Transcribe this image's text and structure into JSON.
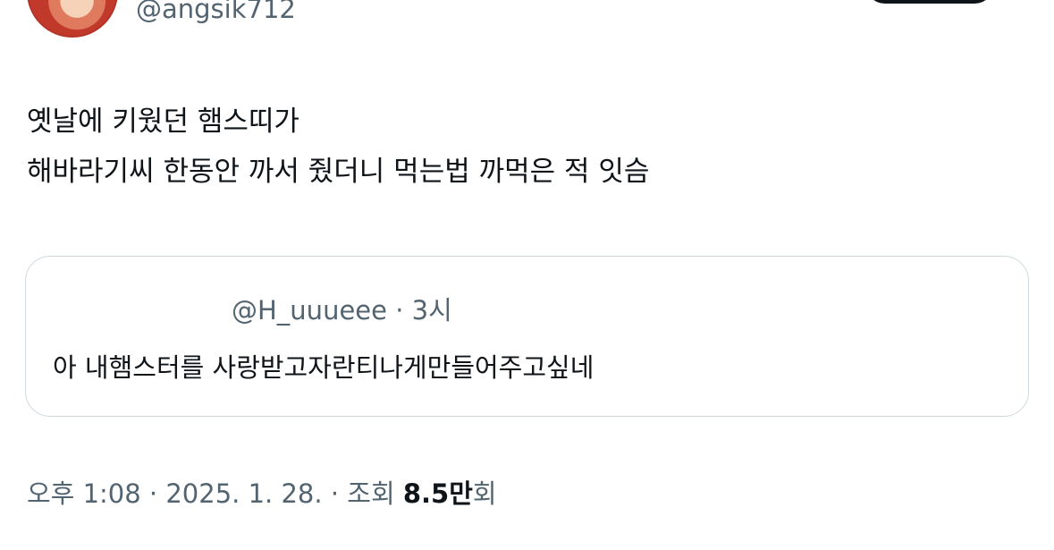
{
  "author": {
    "handle": "@angsik712"
  },
  "tweet": {
    "lines": [
      "옛날에 키웠던 햄스띠가",
      "해바라기씨 한동안 까서 줬더니 먹는법 까먹은 적 잇슴"
    ]
  },
  "quote": {
    "handle": "@H_uuueee",
    "separator": " · ",
    "time": "3시",
    "text": "아 내햄스터를 사랑받고자란티나게만들어주고싶네"
  },
  "meta": {
    "time": "오후 1:08",
    "separator": " · ",
    "date": "2025. 1. 28.",
    "views_label": "조회",
    "views_count": "8.5만",
    "views_suffix": "회"
  },
  "colors": {
    "text_primary": "#0f1419",
    "text_secondary": "#536471",
    "border": "#cfd9de"
  }
}
